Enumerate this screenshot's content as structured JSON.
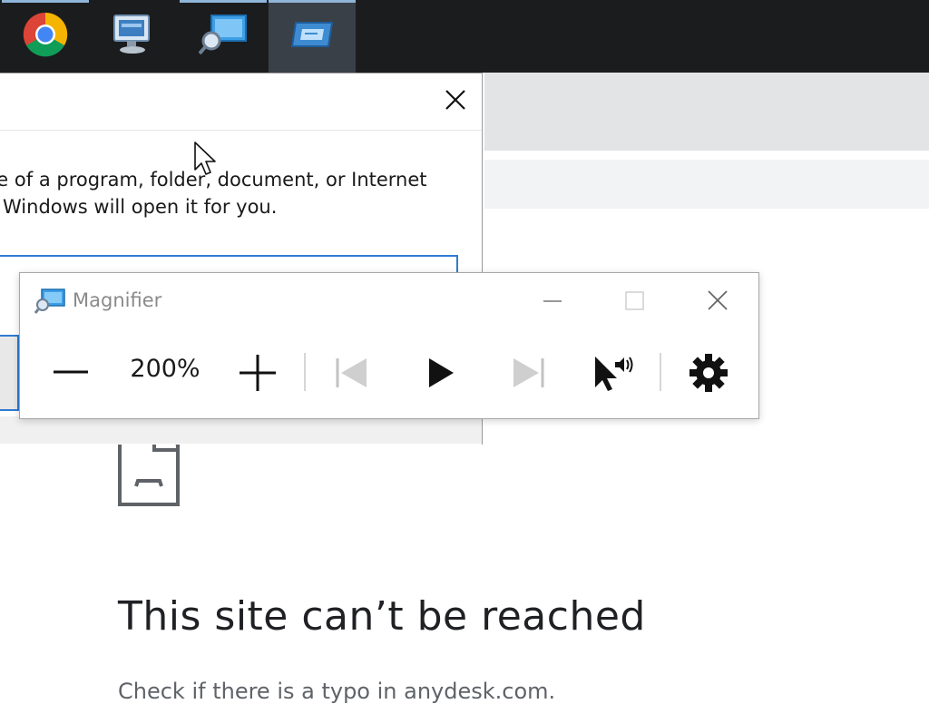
{
  "taskbar": {
    "items": [
      {
        "name": "Google Chrome",
        "icon": "chrome-icon",
        "active": false
      },
      {
        "name": "Network",
        "icon": "network-computer-icon",
        "active": false
      },
      {
        "name": "Magnifier",
        "icon": "magnifier-icon",
        "active": false
      },
      {
        "name": "Run",
        "icon": "run-icon",
        "active": true
      }
    ],
    "accent": "#8fb5d9"
  },
  "run_dialog": {
    "description_line1": "ne of a program, folder, document, or Internet",
    "description_line2": "d Windows will open it for you."
  },
  "magnifier": {
    "title": "Magnifier",
    "zoom": "200%"
  },
  "browser": {
    "error_title": "This site can’t be reached",
    "error_body": "Check if there is a typo in anydesk.com."
  },
  "colors": {
    "focus_blue": "#2f7bd1",
    "taskbar": "#1b1c1e"
  }
}
